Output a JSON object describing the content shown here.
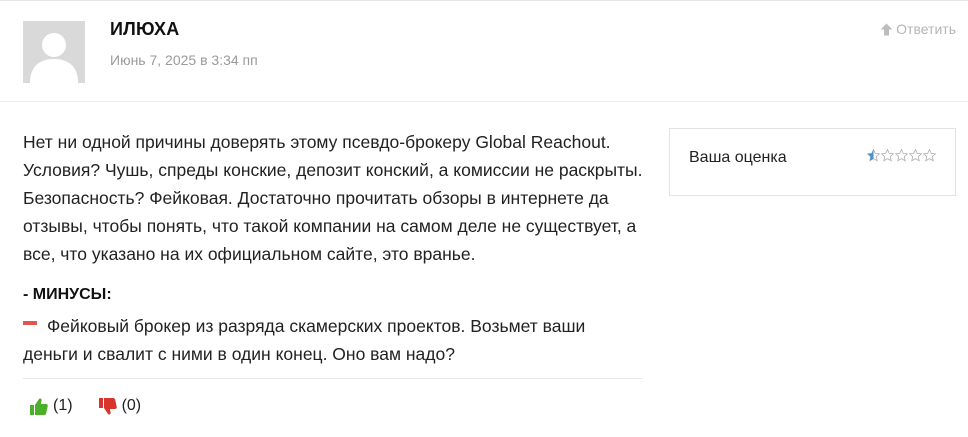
{
  "comment": {
    "author": "ИЛЮХА",
    "date": "Июнь 7, 2025 в 3:34 пп",
    "reply_label": "Ответить",
    "text": "Нет ни одной причины доверять этому псевдо-брокеру Global Reachout. Условия? Чушь, спреды конские, депозит конский, а комиссии не раскрыты. Безопасность? Фейковая. Достаточно прочитать обзоры в интернете да отзывы, чтобы понять, что такой компании на самом деле не существует, а все, что указано на их официальном сайте, это вранье.",
    "cons": {
      "title": "- МИНУСЫ:",
      "items": [
        "Фейковый брокер из разряда скамерских проектов. Возьмет ваши деньги и свалит с ними в один конец. Оно вам надо?"
      ]
    },
    "votes": {
      "likes": "(1)",
      "dislikes": "(0)"
    }
  },
  "rating": {
    "label": "Ваша оценка",
    "value": 0.5,
    "max": 5
  },
  "colors": {
    "minus": "#e25555",
    "like": "#4caf2a",
    "dislike": "#d9342b",
    "star": "#4a90c8"
  },
  "icons": {
    "reply": "arrow-up-icon",
    "like": "thumbs-up-icon",
    "dislike": "thumbs-down-icon",
    "star": "star-icon"
  }
}
